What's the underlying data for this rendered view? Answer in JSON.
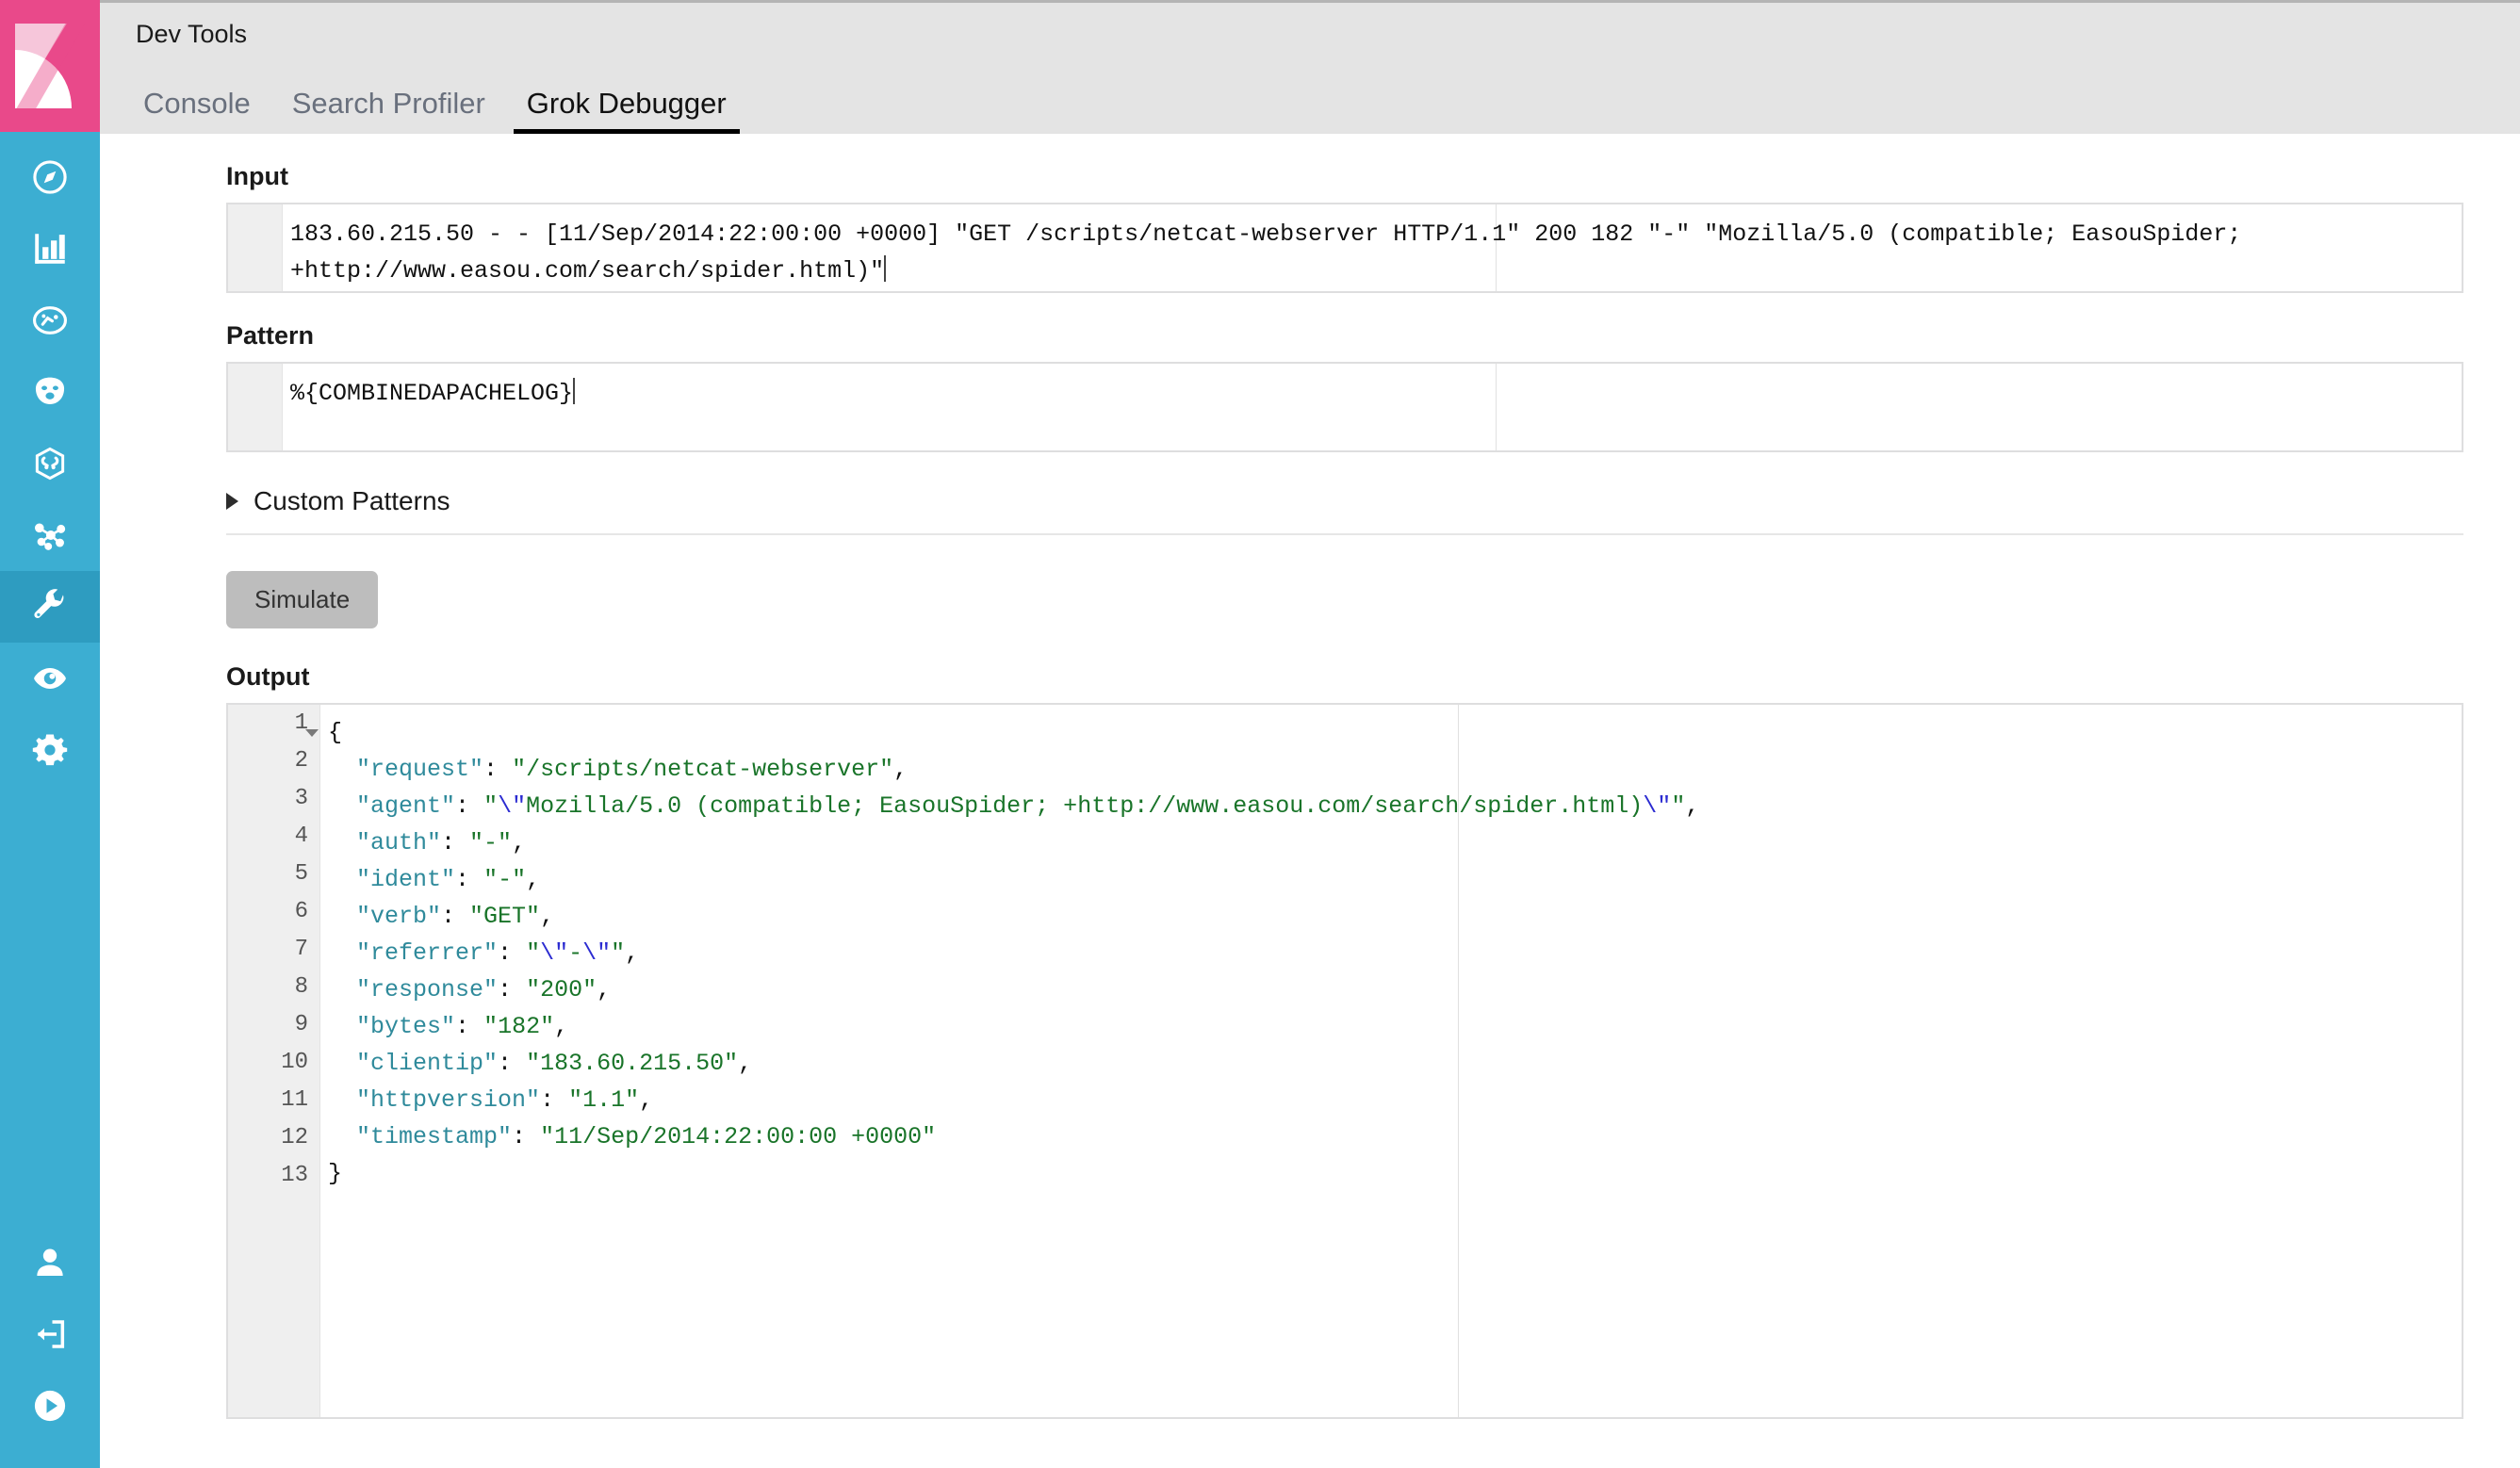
{
  "app": {
    "title": "Dev Tools",
    "logo_color": "#e9498a",
    "sidebar_color": "#3caed2",
    "accent_color": "#e9498a"
  },
  "tabs": [
    {
      "label": "Console",
      "active": false
    },
    {
      "label": "Search Profiler",
      "active": false
    },
    {
      "label": "Grok Debugger",
      "active": true
    }
  ],
  "sidebar": {
    "top_items": [
      {
        "icon": "discover-compass-icon",
        "active": false
      },
      {
        "icon": "visualize-bar-chart-icon",
        "active": false
      },
      {
        "icon": "dashboard-icon",
        "active": false
      },
      {
        "icon": "canvas-icon",
        "active": false
      },
      {
        "icon": "maps-icon",
        "active": false
      },
      {
        "icon": "graph-network-icon",
        "active": false
      },
      {
        "icon": "dev-tools-wrench-icon",
        "active": true
      },
      {
        "icon": "monitoring-eye-icon",
        "active": false
      },
      {
        "icon": "management-gear-icon",
        "active": false
      }
    ],
    "bottom_items": [
      {
        "icon": "user-avatar-icon"
      },
      {
        "icon": "logout-icon"
      },
      {
        "icon": "collapse-play-icon"
      }
    ]
  },
  "sections": {
    "input": {
      "label": "Input",
      "value_line1": "183.60.215.50 - - [11/Sep/2014:22:00:00 +0000] \"GET /scripts/netcat-webserver HTTP/1.1\" 200 182 \"-\" \"Mozilla/5.0 (compatible; EasouSpider;",
      "value_line2": "+http://www.easou.com/search/spider.html)\""
    },
    "pattern": {
      "label": "Pattern",
      "value": "%{COMBINEDAPACHELOG}"
    },
    "custom_patterns": {
      "label": "Custom Patterns",
      "expanded": false
    },
    "simulate": {
      "label": "Simulate"
    },
    "output": {
      "label": "Output",
      "line_numbers": [
        "1",
        "2",
        "3",
        "4",
        "5",
        "6",
        "7",
        "8",
        "9",
        "10",
        "11",
        "12",
        "13"
      ],
      "lines": [
        {
          "n": 1,
          "indent": 0,
          "type": "brace",
          "text": "{"
        },
        {
          "n": 2,
          "indent": 1,
          "type": "pair",
          "key": "request",
          "value": "/scripts/netcat-webserver",
          "comma": true
        },
        {
          "n": 3,
          "indent": 1,
          "type": "pair-escaped",
          "key": "agent",
          "value": "\\\"Mozilla/5.0 (compatible; EasouSpider; +http://www.easou.com/search/spider.html)\\\"",
          "comma": true
        },
        {
          "n": 4,
          "indent": 1,
          "type": "pair",
          "key": "auth",
          "value": "-",
          "comma": true
        },
        {
          "n": 5,
          "indent": 1,
          "type": "pair",
          "key": "ident",
          "value": "-",
          "comma": true
        },
        {
          "n": 6,
          "indent": 1,
          "type": "pair",
          "key": "verb",
          "value": "GET",
          "comma": true
        },
        {
          "n": 7,
          "indent": 1,
          "type": "pair-escaped",
          "key": "referrer",
          "value": "\\\"-\\\"",
          "comma": true
        },
        {
          "n": 8,
          "indent": 1,
          "type": "pair",
          "key": "response",
          "value": "200",
          "comma": true
        },
        {
          "n": 9,
          "indent": 1,
          "type": "pair",
          "key": "bytes",
          "value": "182",
          "comma": true
        },
        {
          "n": 10,
          "indent": 1,
          "type": "pair",
          "key": "clientip",
          "value": "183.60.215.50",
          "comma": true
        },
        {
          "n": 11,
          "indent": 1,
          "type": "pair",
          "key": "httpversion",
          "value": "1.1",
          "comma": true
        },
        {
          "n": 12,
          "indent": 1,
          "type": "pair",
          "key": "timestamp",
          "value": "11/Sep/2014:22:00:00 +0000",
          "comma": false
        },
        {
          "n": 13,
          "indent": 0,
          "type": "brace",
          "text": "}"
        }
      ],
      "parsed_fields": {
        "request": "/scripts/netcat-webserver",
        "agent": "\"Mozilla/5.0 (compatible; EasouSpider; +http://www.easou.com/search/spider.html)\"",
        "auth": "-",
        "ident": "-",
        "verb": "GET",
        "referrer": "\"-\"",
        "response": "200",
        "bytes": "182",
        "clientip": "183.60.215.50",
        "httpversion": "1.1",
        "timestamp": "11/Sep/2014:22:00:00 +0000"
      }
    }
  }
}
